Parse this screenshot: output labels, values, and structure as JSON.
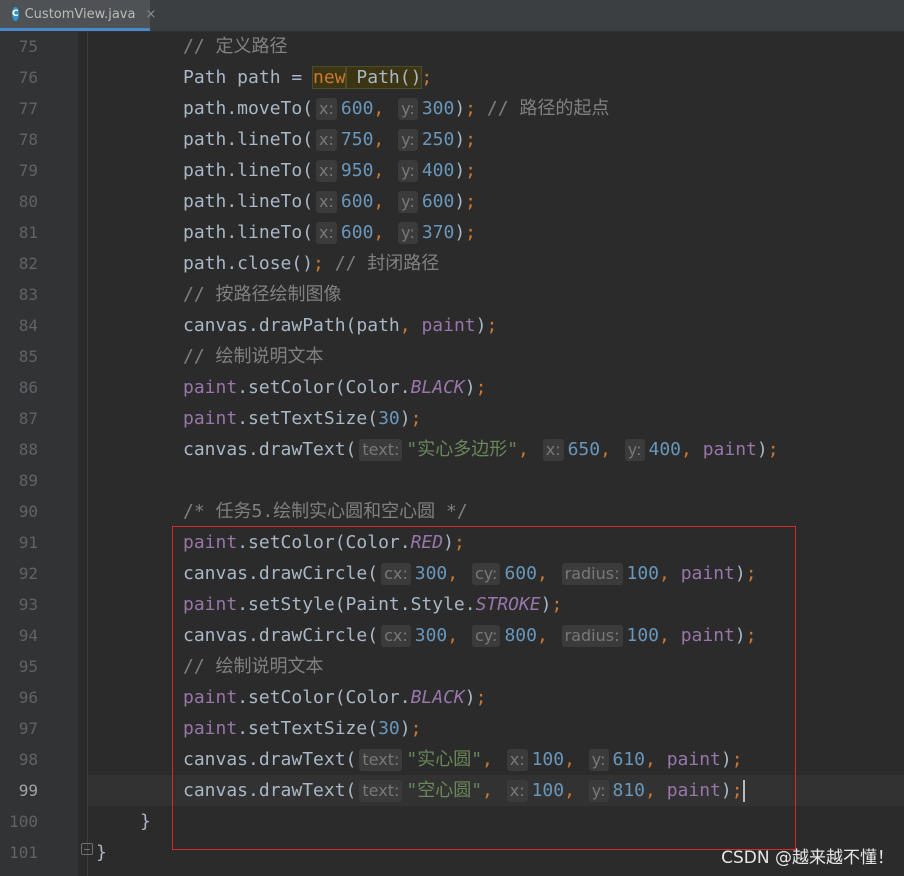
{
  "tab": {
    "label": "CustomView.java",
    "icon": "C",
    "close": "×"
  },
  "lines": [
    {
      "n": "75",
      "tokens": [
        [
          "comment",
          "// 定义路径"
        ]
      ]
    },
    {
      "n": "76",
      "tokens": [
        [
          "plain",
          "Path path = "
        ],
        [
          "kwhl",
          "new"
        ],
        [
          "hl",
          " Path()"
        ],
        [
          "kw",
          ";"
        ]
      ]
    },
    {
      "n": "77",
      "tokens": [
        [
          "plain",
          "path.moveTo("
        ],
        [
          "hint",
          "x:"
        ],
        [
          "num",
          "600"
        ],
        [
          "kw",
          ", "
        ],
        [
          "hint",
          "y:"
        ],
        [
          "num",
          "300"
        ],
        [
          "plain",
          ")"
        ],
        [
          "kw",
          ";"
        ],
        [
          "comment",
          " // 路径的起点"
        ]
      ]
    },
    {
      "n": "78",
      "tokens": [
        [
          "plain",
          "path.lineTo("
        ],
        [
          "hint",
          "x:"
        ],
        [
          "num",
          "750"
        ],
        [
          "kw",
          ", "
        ],
        [
          "hint",
          "y:"
        ],
        [
          "num",
          "250"
        ],
        [
          "plain",
          ")"
        ],
        [
          "kw",
          ";"
        ]
      ]
    },
    {
      "n": "79",
      "tokens": [
        [
          "plain",
          "path.lineTo("
        ],
        [
          "hint",
          "x:"
        ],
        [
          "num",
          "950"
        ],
        [
          "kw",
          ", "
        ],
        [
          "hint",
          "y:"
        ],
        [
          "num",
          "400"
        ],
        [
          "plain",
          ")"
        ],
        [
          "kw",
          ";"
        ]
      ]
    },
    {
      "n": "80",
      "tokens": [
        [
          "plain",
          "path.lineTo("
        ],
        [
          "hint",
          "x:"
        ],
        [
          "num",
          "600"
        ],
        [
          "kw",
          ", "
        ],
        [
          "hint",
          "y:"
        ],
        [
          "num",
          "600"
        ],
        [
          "plain",
          ")"
        ],
        [
          "kw",
          ";"
        ]
      ]
    },
    {
      "n": "81",
      "tokens": [
        [
          "plain",
          "path.lineTo("
        ],
        [
          "hint",
          "x:"
        ],
        [
          "num",
          "600"
        ],
        [
          "kw",
          ", "
        ],
        [
          "hint",
          "y:"
        ],
        [
          "num",
          "370"
        ],
        [
          "plain",
          ")"
        ],
        [
          "kw",
          ";"
        ]
      ]
    },
    {
      "n": "82",
      "tokens": [
        [
          "plain",
          "path.close()"
        ],
        [
          "kw",
          ";"
        ],
        [
          "comment",
          " // 封闭路径"
        ]
      ]
    },
    {
      "n": "83",
      "tokens": [
        [
          "comment",
          "// 按路径绘制图像"
        ]
      ]
    },
    {
      "n": "84",
      "tokens": [
        [
          "plain",
          "canvas.drawPath(path"
        ],
        [
          "kw",
          ", "
        ],
        [
          "field",
          "paint"
        ],
        [
          "plain",
          ")"
        ],
        [
          "kw",
          ";"
        ]
      ]
    },
    {
      "n": "85",
      "tokens": [
        [
          "comment",
          "// 绘制说明文本"
        ]
      ]
    },
    {
      "n": "86",
      "tokens": [
        [
          "field",
          "paint"
        ],
        [
          "plain",
          ".setColor(Color."
        ],
        [
          "ifield",
          "BLACK"
        ],
        [
          "plain",
          ")"
        ],
        [
          "kw",
          ";"
        ]
      ]
    },
    {
      "n": "87",
      "tokens": [
        [
          "field",
          "paint"
        ],
        [
          "plain",
          ".setTextSize("
        ],
        [
          "num",
          "30"
        ],
        [
          "plain",
          ")"
        ],
        [
          "kw",
          ";"
        ]
      ]
    },
    {
      "n": "88",
      "tokens": [
        [
          "plain",
          "canvas.drawText("
        ],
        [
          "hint",
          "text:"
        ],
        [
          "str",
          "\"实心多边形\""
        ],
        [
          "kw",
          ", "
        ],
        [
          "hint",
          "x:"
        ],
        [
          "num",
          "650"
        ],
        [
          "kw",
          ", "
        ],
        [
          "hint",
          "y:"
        ],
        [
          "num",
          "400"
        ],
        [
          "kw",
          ", "
        ],
        [
          "field",
          "paint"
        ],
        [
          "plain",
          ")"
        ],
        [
          "kw",
          ";"
        ]
      ]
    },
    {
      "n": "89",
      "tokens": []
    },
    {
      "n": "90",
      "tokens": [
        [
          "comment",
          "/* 任务5.绘制实心圆和空心圆 */"
        ]
      ]
    },
    {
      "n": "91",
      "tokens": [
        [
          "field",
          "paint"
        ],
        [
          "plain",
          ".setColor(Color."
        ],
        [
          "ifield",
          "RED"
        ],
        [
          "plain",
          ")"
        ],
        [
          "kw",
          ";"
        ]
      ]
    },
    {
      "n": "92",
      "tokens": [
        [
          "plain",
          "canvas.drawCircle("
        ],
        [
          "hint",
          "cx:"
        ],
        [
          "num",
          "300"
        ],
        [
          "kw",
          ", "
        ],
        [
          "hint",
          "cy:"
        ],
        [
          "num",
          "600"
        ],
        [
          "kw",
          ", "
        ],
        [
          "hint",
          "radius:"
        ],
        [
          "num",
          "100"
        ],
        [
          "kw",
          ", "
        ],
        [
          "field",
          "paint"
        ],
        [
          "plain",
          ")"
        ],
        [
          "kw",
          ";"
        ]
      ]
    },
    {
      "n": "93",
      "tokens": [
        [
          "field",
          "paint"
        ],
        [
          "plain",
          ".setStyle(Paint.Style."
        ],
        [
          "ifield",
          "STROKE"
        ],
        [
          "plain",
          ")"
        ],
        [
          "kw",
          ";"
        ]
      ]
    },
    {
      "n": "94",
      "tokens": [
        [
          "plain",
          "canvas.drawCircle("
        ],
        [
          "hint",
          "cx:"
        ],
        [
          "num",
          "300"
        ],
        [
          "kw",
          ", "
        ],
        [
          "hint",
          "cy:"
        ],
        [
          "num",
          "800"
        ],
        [
          "kw",
          ", "
        ],
        [
          "hint",
          "radius:"
        ],
        [
          "num",
          "100"
        ],
        [
          "kw",
          ", "
        ],
        [
          "field",
          "paint"
        ],
        [
          "plain",
          ")"
        ],
        [
          "kw",
          ";"
        ]
      ]
    },
    {
      "n": "95",
      "tokens": [
        [
          "comment",
          "// 绘制说明文本"
        ]
      ]
    },
    {
      "n": "96",
      "tokens": [
        [
          "field",
          "paint"
        ],
        [
          "plain",
          ".setColor(Color."
        ],
        [
          "ifield",
          "BLACK"
        ],
        [
          "plain",
          ")"
        ],
        [
          "kw",
          ";"
        ]
      ]
    },
    {
      "n": "97",
      "tokens": [
        [
          "field",
          "paint"
        ],
        [
          "plain",
          ".setTextSize("
        ],
        [
          "num",
          "30"
        ],
        [
          "plain",
          ")"
        ],
        [
          "kw",
          ";"
        ]
      ]
    },
    {
      "n": "98",
      "tokens": [
        [
          "plain",
          "canvas.drawText("
        ],
        [
          "hint",
          "text:"
        ],
        [
          "str",
          "\"实心圆\""
        ],
        [
          "kw",
          ", "
        ],
        [
          "hint",
          "x:"
        ],
        [
          "num",
          "100"
        ],
        [
          "kw",
          ", "
        ],
        [
          "hint",
          "y:"
        ],
        [
          "num",
          "610"
        ],
        [
          "kw",
          ", "
        ],
        [
          "field",
          "paint"
        ],
        [
          "plain",
          ")"
        ],
        [
          "kw",
          ";"
        ]
      ]
    },
    {
      "n": "99",
      "tokens": [
        [
          "plain",
          "canvas.drawText("
        ],
        [
          "hint",
          "text:"
        ],
        [
          "str",
          "\"空心圆\""
        ],
        [
          "kw",
          ", "
        ],
        [
          "hint",
          "x:"
        ],
        [
          "num",
          "100"
        ],
        [
          "kw",
          ", "
        ],
        [
          "hint",
          "y:"
        ],
        [
          "num",
          "810"
        ],
        [
          "kw",
          ", "
        ],
        [
          "field",
          "paint"
        ],
        [
          "plain",
          ")"
        ],
        [
          "kw",
          ";"
        ],
        [
          "caret",
          ""
        ]
      ],
      "current": true
    },
    {
      "n": "100",
      "tokens": [
        [
          "plain",
          "}"
        ]
      ]
    },
    {
      "n": "101",
      "tokens": [
        [
          "plain",
          "}"
        ]
      ]
    }
  ],
  "watermark": "CSDN @越来越不懂！"
}
